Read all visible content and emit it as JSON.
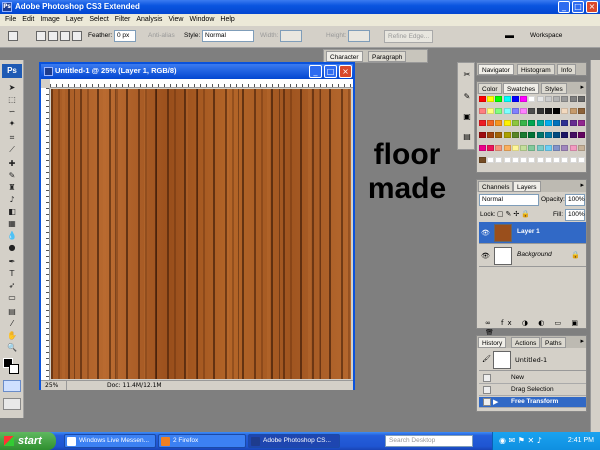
{
  "app": {
    "title": "Adobe Photoshop CS3 Extended",
    "logo": "Ps"
  },
  "menu": [
    "File",
    "Edit",
    "Image",
    "Layer",
    "Select",
    "Filter",
    "Analysis",
    "View",
    "Window",
    "Help"
  ],
  "options": {
    "feather_label": "Feather:",
    "feather_value": "0 px",
    "anti_alias": "Anti-alias",
    "style_label": "Style:",
    "style_value": "Normal",
    "width_label": "Width:",
    "height_label": "Height:",
    "refine_edge": "Refine Edge...",
    "workspace": "Workspace"
  },
  "document": {
    "title": "Untitled-1 @ 25% (Layer 1, RGB/8)",
    "zoom": "25%",
    "doc_info": "Doc: 11.4M/12.1M"
  },
  "overlay_text": {
    "line1": "floor",
    "line2": "made"
  },
  "panels": {
    "character_tabs": [
      "Character",
      "Paragraph"
    ],
    "navigator_tabs": [
      "Navigator",
      "Histogram",
      "Info"
    ],
    "swatch_tabs": [
      "Color",
      "Swatches",
      "Styles"
    ],
    "layers_tabs": [
      "Channels",
      "Layers"
    ],
    "blend_mode": "Normal",
    "opacity_label": "Opacity:",
    "opacity_value": "100%",
    "lock_label": "Lock:",
    "fill_label": "Fill:",
    "fill_value": "100%",
    "layers": [
      {
        "name": "Layer 1",
        "selected": true
      },
      {
        "name": "Background",
        "selected": false
      }
    ],
    "history_tabs": [
      "History",
      "Actions",
      "Paths"
    ],
    "history_snapshot": "Untitled-1",
    "history_items": [
      {
        "name": "New",
        "selected": false
      },
      {
        "name": "Drag Selection",
        "selected": false
      },
      {
        "name": "Free Transform",
        "selected": true
      }
    ]
  },
  "swatch_colors": [
    "#ff0000",
    "#ffff00",
    "#00ff00",
    "#00ffff",
    "#0000ff",
    "#ff00ff",
    "#ffffff",
    "#e6e6e6",
    "#cccccc",
    "#b3b3b3",
    "#999999",
    "#808080",
    "#666666",
    "#ff8080",
    "#ffff80",
    "#80ff80",
    "#80ffff",
    "#8080ff",
    "#ff80ff",
    "#4d4d4d",
    "#333333",
    "#1a1a1a",
    "#000000",
    "#f2d9bf",
    "#c69c6d",
    "#8c6239",
    "#ed1c24",
    "#f26522",
    "#f7941d",
    "#fff200",
    "#8dc63f",
    "#39b54a",
    "#00a651",
    "#00a99d",
    "#00aeef",
    "#0072bc",
    "#2e3192",
    "#662d91",
    "#92278f",
    "#9e0b0f",
    "#a0410d",
    "#a36209",
    "#aba000",
    "#598527",
    "#197b30",
    "#007236",
    "#00746b",
    "#0076a3",
    "#004a80",
    "#1b1464",
    "#440e62",
    "#630460",
    "#ec008c",
    "#ed145b",
    "#f69679",
    "#fbaf5d",
    "#fff799",
    "#c4df9b",
    "#82ca9c",
    "#7accc8",
    "#6dcff6",
    "#8393ca",
    "#a187be",
    "#f49ac1",
    "#c7b299",
    "#754c24",
    "#ffffff",
    "#ffffff",
    "#ffffff",
    "#ffffff",
    "#ffffff",
    "#ffffff",
    "#ffffff",
    "#ffffff",
    "#ffffff",
    "#ffffff",
    "#ffffff",
    "#ffffff"
  ],
  "taskbar": {
    "start": "start",
    "tasks": [
      {
        "label": "Windows Live Messen..."
      },
      {
        "label": "2 Firefox"
      },
      {
        "label": "Adobe Photoshop CS..."
      }
    ],
    "search_placeholder": "Search Desktop",
    "clock": "2:41 PM"
  }
}
